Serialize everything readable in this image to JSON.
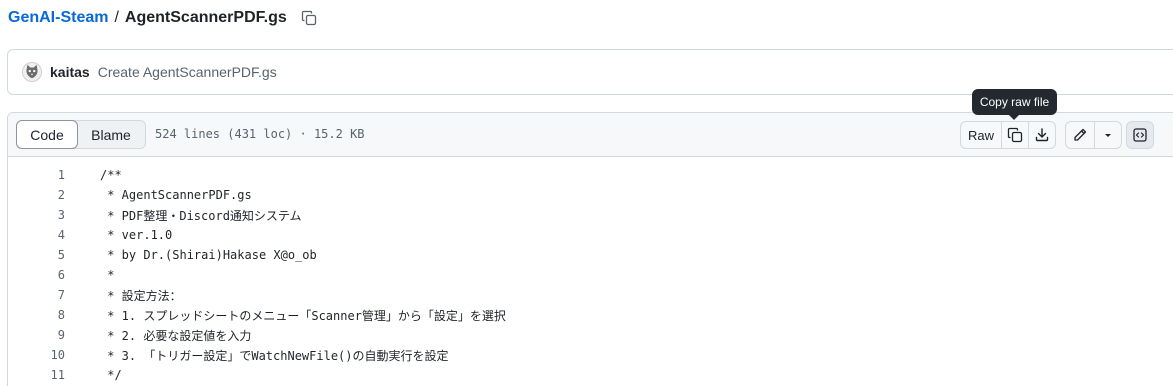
{
  "breadcrumb": {
    "repo": "GenAI-Steam",
    "separator": "/",
    "file": "AgentScannerPDF.gs",
    "copy_icon": "copy-icon"
  },
  "commit": {
    "author": "kaitas",
    "message": "Create AgentScannerPDF.gs",
    "avatar_icon": "cat-avatar-icon"
  },
  "file_header": {
    "tabs": [
      "Code",
      "Blame"
    ],
    "active_tab": "Code",
    "meta": "524 lines (431 loc) · 15.2 KB",
    "raw_label": "Raw",
    "tooltip": "Copy raw file",
    "icons": [
      "copy-icon",
      "download-icon",
      "pencil-icon",
      "chevron-down-icon",
      "code-square-icon"
    ]
  },
  "code": {
    "lines": [
      {
        "n": "1",
        "text": "/**"
      },
      {
        "n": "2",
        "text": " * AgentScannerPDF.gs"
      },
      {
        "n": "3",
        "text": " * PDF整理・Discord通知システム"
      },
      {
        "n": "4",
        "text": " * ver.1.0"
      },
      {
        "n": "5",
        "text": " * by Dr.(Shirai)Hakase X@o_ob"
      },
      {
        "n": "6",
        "text": " *"
      },
      {
        "n": "7",
        "text": " * 設定方法："
      },
      {
        "n": "8",
        "text": " * 1. スプレッドシートのメニュー「Scanner管理」から「設定」を選択"
      },
      {
        "n": "9",
        "text": " * 2. 必要な設定値を入力"
      },
      {
        "n": "10",
        "text": " * 3. 「トリガー設定」でWatchNewFile()の自動実行を設定"
      },
      {
        "n": "11",
        "text": " */"
      }
    ]
  },
  "colors": {
    "link": "#0969da",
    "border": "#d1d9e0",
    "header_bg": "#f6f8fa",
    "tooltip_bg": "#24292f"
  }
}
